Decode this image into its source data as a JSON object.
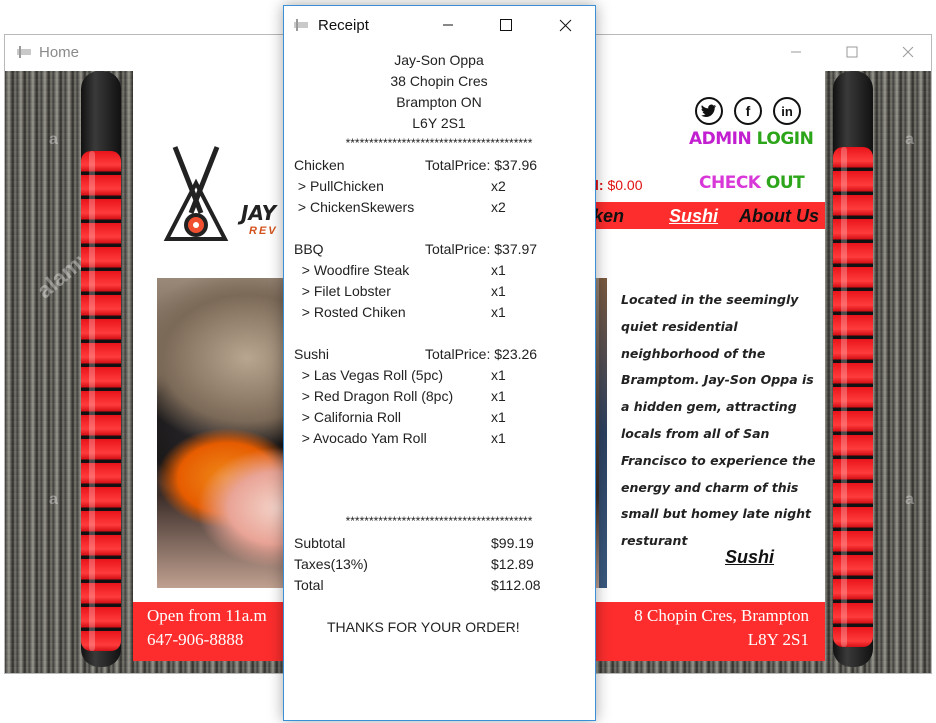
{
  "home_window": {
    "title": "Home",
    "watermark": "alamy",
    "admin_login": {
      "part1": "ADMIN",
      "part2": "LOGIN"
    },
    "total_label": "l:",
    "total_value": "$0.00",
    "check_out": {
      "part1": "CHECK",
      "part2": "OUT"
    },
    "nav": {
      "chicken": "cken",
      "sushi": "Sushi",
      "about": "About Us"
    },
    "brand": {
      "name": "JAY",
      "sub": "REV"
    },
    "about_text": "Located in the seemingly quiet residential neighborhood of the Bramptom. Jay-Son Oppa is a hidden gem, attracting locals from all of San Francisco to experience the energy and charm of this small but homey late night resturant",
    "sushi_link": "Sushi",
    "footer": {
      "hours": "Open from 11a.m",
      "phone": "647-906-8888",
      "address": "8 Chopin Cres, Brampton",
      "postal": "L8Y 2S1"
    },
    "social": [
      "twitter-icon",
      "facebook-icon",
      "linkedin-icon"
    ],
    "colors": {
      "nav_red": "#fd2d2d",
      "admin_purple": "#c21fd0",
      "green": "#2da51a",
      "checkout_pink": "#d838d8"
    }
  },
  "receipt_window": {
    "title": "Receipt",
    "header": [
      "Jay-Son Oppa",
      "38 Chopin Cres",
      "Brampton ON",
      "L6Y 2S1"
    ],
    "separator": "****************************************",
    "sections": [
      {
        "name": "Chicken",
        "total": "TotalPrice: $37.96",
        "items": [
          {
            "name": " > PullChicken",
            "qty": "x2"
          },
          {
            "name": " > ChickenSkewers",
            "qty": "x2"
          }
        ]
      },
      {
        "name": "BBQ",
        "total": "TotalPrice: $37.97",
        "items": [
          {
            "name": "  > Woodfire Steak",
            "qty": "x1"
          },
          {
            "name": "  > Filet Lobster",
            "qty": "x1"
          },
          {
            "name": "  > Rosted Chiken",
            "qty": "x1"
          }
        ]
      },
      {
        "name": "Sushi",
        "total": "TotalPrice: $23.26",
        "items": [
          {
            "name": "  > Las Vegas Roll (5pc)",
            "qty": "x1"
          },
          {
            "name": "  > Red Dragon Roll (8pc)",
            "qty": "x1"
          },
          {
            "name": "  > California Roll",
            "qty": "x1"
          },
          {
            "name": "  > Avocado Yam Roll",
            "qty": "x1"
          }
        ]
      }
    ],
    "summary": [
      {
        "label": "Subtotal",
        "value": "$99.19"
      },
      {
        "label": "Taxes(13%)",
        "value": "$12.89"
      },
      {
        "label": "Total",
        "value": "$112.08"
      }
    ],
    "thanks": "THANKS FOR YOUR ORDER!"
  }
}
